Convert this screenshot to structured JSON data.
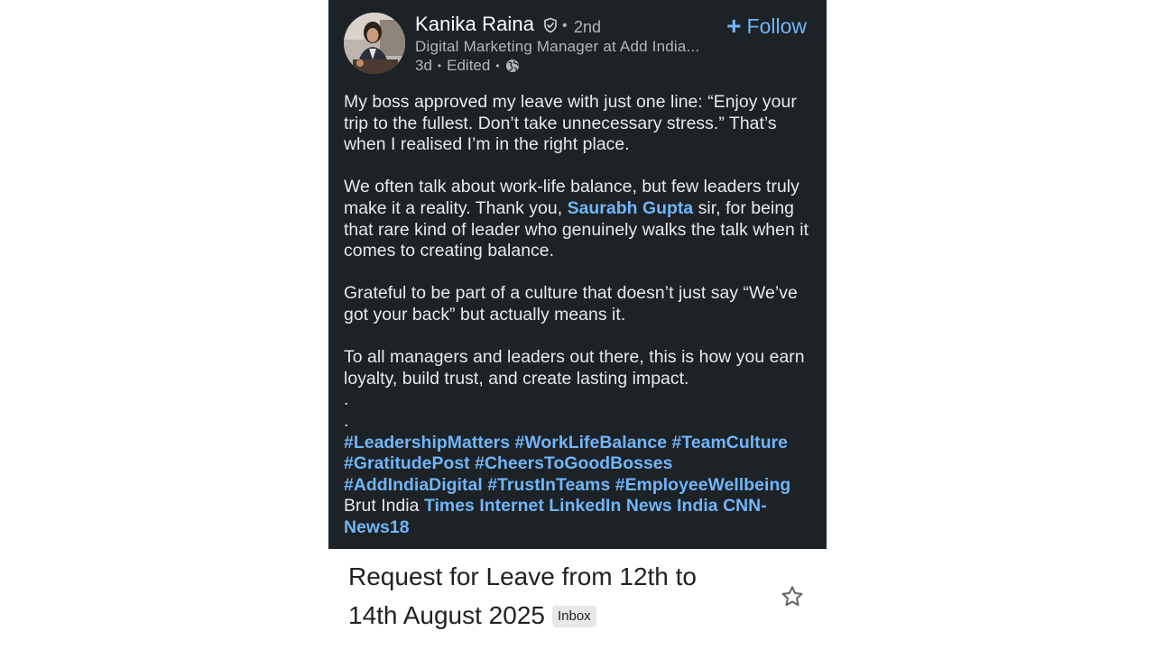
{
  "post": {
    "author": {
      "name": "Kanika Raina",
      "degree": "2nd",
      "headline": "Digital Marketing Manager at Add India...",
      "age": "3d",
      "edited": "Edited",
      "visibility_icon": "globe-icon",
      "verified_icon": "verified-shield-icon"
    },
    "follow_label": "Follow",
    "paragraphs": {
      "p1": "My boss approved my leave with just one line: “Enjoy your trip to the fullest. Don’t take unnecessary stress.” That’s when I realised I’m in the right place.",
      "p2_before": "We often talk about work-life balance, but few leaders truly make it a reality. Thank you, ",
      "p2_mention": "Saurabh Gupta",
      "p2_after": " sir, for being that rare kind of leader who genuinely walks the talk when it comes to creating balance.",
      "p3": "Grateful to be part of a culture that doesn’t just say “We’ve got your back” but actually means it.",
      "p4": "To all managers and leaders out there, this is how you earn loyalty, build trust, and create lasting impact.",
      "dot1": ".",
      "dot2": "."
    },
    "hashtags": [
      "#LeadershipMatters",
      "#WorkLifeBalance",
      "#TeamCulture",
      "#GratitudePost",
      "#CheersToGoodBosses",
      "#AddIndiaDigital",
      "#TrustInTeams",
      "#EmployeeWellbeing"
    ],
    "tags": {
      "plain": "Brut India",
      "linked": [
        "Times Internet",
        "LinkedIn News India",
        "CNN-News18"
      ]
    }
  },
  "email": {
    "subject": "Request for Leave from 12th to 14th August 2025",
    "label": "Inbox",
    "star_icon": "star-outline-icon"
  },
  "colors": {
    "card_background": "#1d2226",
    "link": "#70b5f9",
    "body_text": "#e9e9e9",
    "muted_text": "#b0b7bc"
  }
}
